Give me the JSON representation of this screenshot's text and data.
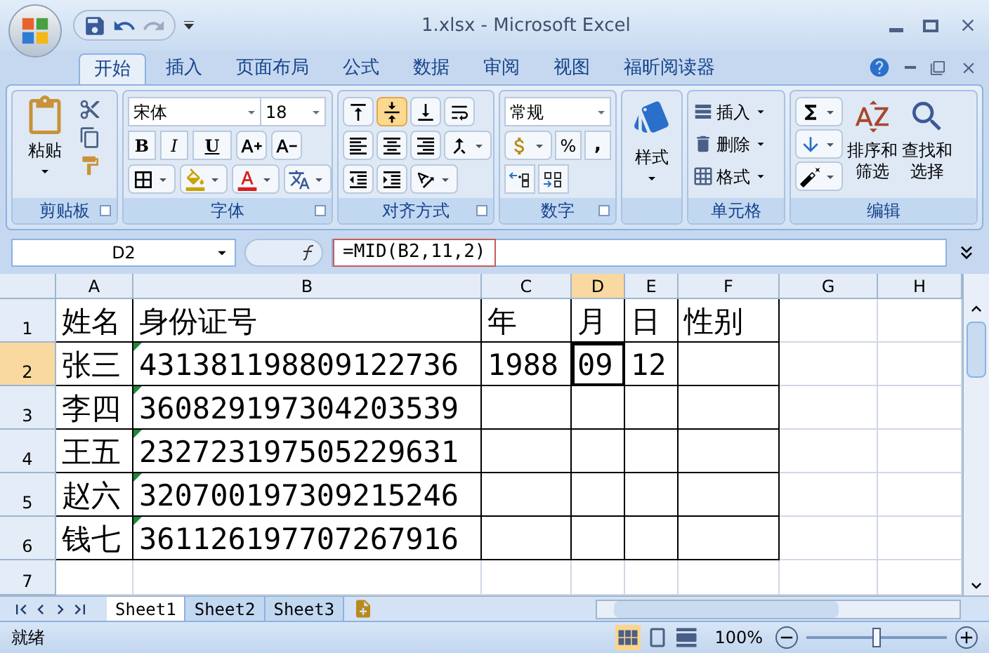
{
  "window": {
    "title": "1.xlsx - Microsoft Excel"
  },
  "tabs": [
    {
      "label": "开始",
      "selected": true
    },
    {
      "label": "插入",
      "selected": false
    },
    {
      "label": "页面布局",
      "selected": false
    },
    {
      "label": "公式",
      "selected": false
    },
    {
      "label": "数据",
      "selected": false
    },
    {
      "label": "审阅",
      "selected": false
    },
    {
      "label": "视图",
      "selected": false
    },
    {
      "label": "福昕阅读器",
      "selected": false
    }
  ],
  "ribbon": {
    "clipboard": {
      "paste": "粘贴",
      "label": "剪贴板"
    },
    "font": {
      "name": "宋体",
      "size": "18",
      "bold": "B",
      "italic": "I",
      "underline": "U",
      "label": "字体"
    },
    "alignment": {
      "label": "对齐方式"
    },
    "number": {
      "format": "常规",
      "percent": "%",
      "comma": ",",
      "label": "数字"
    },
    "styles": {
      "button": "样式"
    },
    "cells": {
      "items": [
        "插入",
        "删除",
        "格式"
      ],
      "label": "单元格"
    },
    "editing": {
      "sort": [
        "排序和",
        "筛选"
      ],
      "find": [
        "查找和",
        "选择"
      ],
      "label": "编辑"
    }
  },
  "formula_bar": {
    "name_box": "D2",
    "formula": "=MID(B2,11,2)"
  },
  "columns": [
    {
      "label": "A",
      "selected": false
    },
    {
      "label": "B",
      "selected": false
    },
    {
      "label": "C",
      "selected": false
    },
    {
      "label": "D",
      "selected": true
    },
    {
      "label": "E",
      "selected": false
    },
    {
      "label": "F",
      "selected": false
    },
    {
      "label": "G",
      "selected": false
    },
    {
      "label": "H",
      "selected": false
    }
  ],
  "rows": [
    {
      "number": "1",
      "selected": false,
      "cells": [
        "姓名",
        "身份证号",
        "年",
        "月",
        "日",
        "性别",
        "",
        ""
      ]
    },
    {
      "number": "2",
      "selected": true,
      "cells": [
        "张三",
        "431381198809122736",
        "1988",
        "09",
        "12",
        "",
        "",
        ""
      ],
      "number_as_text": true
    },
    {
      "number": "3",
      "selected": false,
      "cells": [
        "李四",
        "360829197304203539",
        "",
        "",
        "",
        "",
        "",
        ""
      ],
      "number_as_text": true
    },
    {
      "number": "4",
      "selected": false,
      "cells": [
        "王五",
        "232723197505229631",
        "",
        "",
        "",
        "",
        "",
        ""
      ],
      "number_as_text": true
    },
    {
      "number": "5",
      "selected": false,
      "cells": [
        "赵六",
        "320700197309215246",
        "",
        "",
        "",
        "",
        "",
        ""
      ],
      "number_as_text": true
    },
    {
      "number": "6",
      "selected": false,
      "cells": [
        "钱七",
        "361126197707267916",
        "",
        "",
        "",
        "",
        "",
        ""
      ],
      "number_as_text": true
    },
    {
      "number": "7",
      "selected": false,
      "cells": [
        "",
        "",
        "",
        "",
        "",
        "",
        "",
        ""
      ]
    }
  ],
  "sheets": [
    {
      "label": "Sheet1",
      "selected": true
    },
    {
      "label": "Sheet2",
      "selected": false
    },
    {
      "label": "Sheet3",
      "selected": false
    }
  ],
  "status_bar": {
    "status": "就绪",
    "zoom": "100%",
    "level": 0.5
  }
}
